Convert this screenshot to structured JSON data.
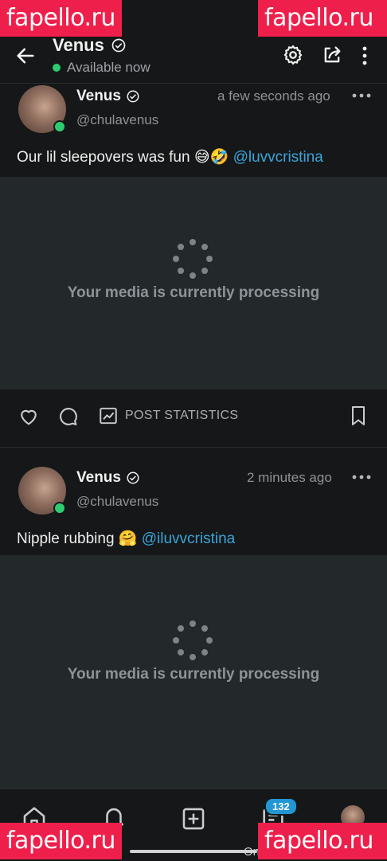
{
  "watermark": {
    "text": "fapello.ru"
  },
  "header": {
    "title": "Venus",
    "status": "Available now"
  },
  "posts": [
    {
      "name": "Venus",
      "handle": "@chulavenus",
      "time": "a few seconds ago",
      "text": "Our lil sleepovers was fun 😅🤣",
      "mention": "@luvvcristina",
      "media_status": "Your media is currently processing",
      "stats_label": "POST STATISTICS"
    },
    {
      "name": "Venus",
      "handle": "@chulavenus",
      "time": "2 minutes ago",
      "text": "Nipple rubbing 🤗",
      "mention": "@iluvvcristina",
      "media_status": "Your media is currently processing"
    }
  ],
  "nav": {
    "notifications_badge": "132",
    "bottom_text": "On"
  },
  "colors": {
    "accent": "#39a5dc",
    "online": "#2ecc71",
    "badge": "#2196d3",
    "watermark": "#ef1f4b"
  }
}
